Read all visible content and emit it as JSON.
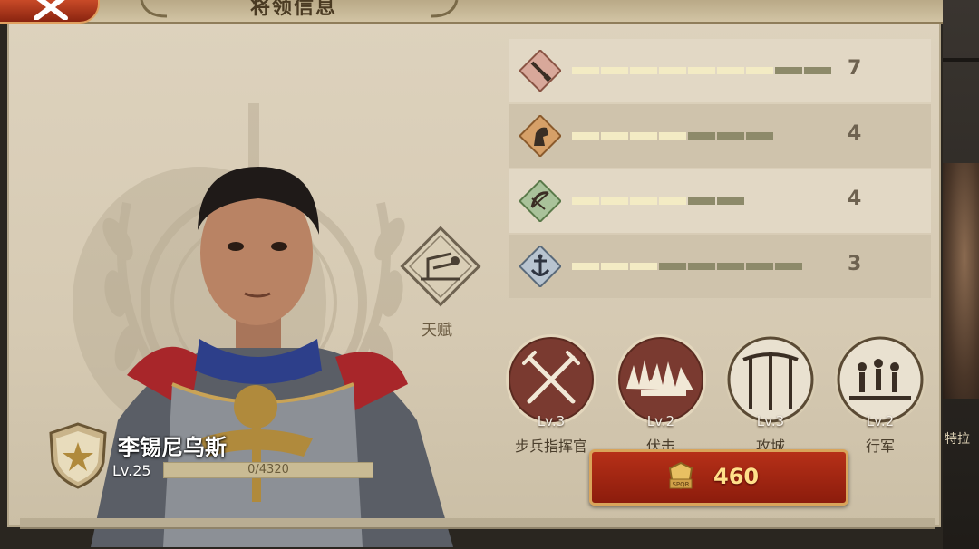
{
  "window": {
    "title": "将领信息"
  },
  "hero": {
    "name": "李锡尼乌斯",
    "level_label": "Lv.25",
    "exp_text": "0/4320"
  },
  "talent": {
    "label": "天赋"
  },
  "stats": [
    {
      "icon": "sword-icon",
      "value": "7",
      "filled": 7,
      "total": 9
    },
    {
      "icon": "cavalry-icon",
      "value": "4",
      "filled": 4,
      "total": 7
    },
    {
      "icon": "bow-icon",
      "value": "4",
      "filled": 4,
      "total": 6
    },
    {
      "icon": "anchor-icon",
      "value": "3",
      "filled": 3,
      "total": 8
    }
  ],
  "skills": [
    {
      "level": "Lv.3",
      "name": "步兵指挥官",
      "icon": "crossed-swords-icon"
    },
    {
      "level": "Lv.2",
      "name": "伏击",
      "icon": "ambush-icon"
    },
    {
      "level": "Lv.3",
      "name": "攻城",
      "icon": "siege-icon"
    },
    {
      "level": "Lv.2",
      "name": "行军",
      "icon": "march-icon"
    }
  ],
  "upgrade": {
    "cost": "460",
    "coin_text": "SPQR"
  },
  "side_peek": {
    "text": "特拉"
  },
  "colors": {
    "bar_on": "#f3ebc4",
    "bar_off": "#8d8a6a",
    "button_red": "#b63018"
  }
}
